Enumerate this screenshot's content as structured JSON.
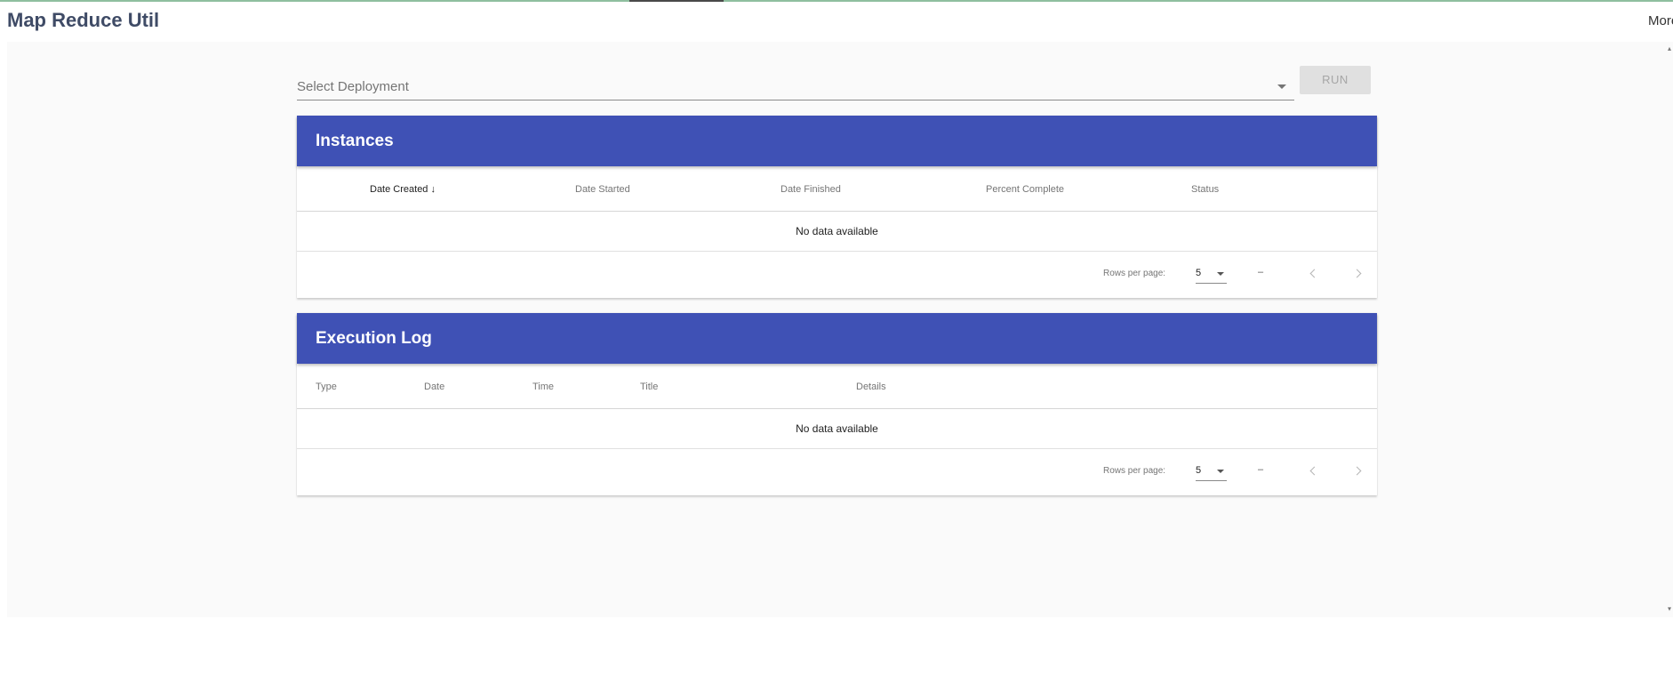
{
  "app": {
    "title": "Map Reduce Util",
    "more_label": "More"
  },
  "toolbar": {
    "select_placeholder": "Select Deployment",
    "run_label": "RUN"
  },
  "instances": {
    "title": "Instances",
    "columns": [
      "Date Created",
      "Date Started",
      "Date Finished",
      "Percent Complete",
      "Status"
    ],
    "sorted_column": "Date Created",
    "sort_direction": "descending",
    "empty_text": "No data available",
    "rows_per_page_label": "Rows per page:",
    "rows_per_page": "5",
    "range_text": "–"
  },
  "execution_log": {
    "title": "Execution Log",
    "columns": [
      "Type",
      "Date",
      "Time",
      "Title",
      "Details"
    ],
    "empty_text": "No data available",
    "rows_per_page_label": "Rows per page:",
    "rows_per_page": "5",
    "range_text": "–"
  },
  "colors": {
    "header": "#3f51b5",
    "app_title": "#3f4b66",
    "background": "#fafafa"
  },
  "icons": {
    "sort": "arrow-down-icon",
    "prev": "chevron-left-icon",
    "next": "chevron-right-icon",
    "dropdown": "caret-down-icon"
  }
}
